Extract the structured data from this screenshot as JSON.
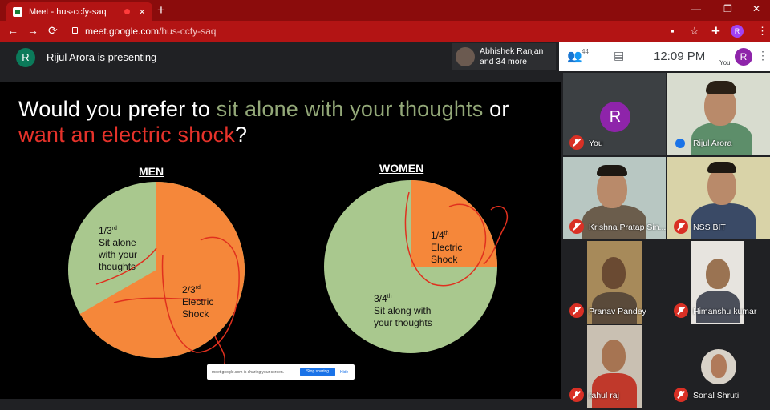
{
  "browser": {
    "tab_title": "Meet - hus-ccfy-saq",
    "tab_close": "×",
    "new_tab": "+",
    "url_domain": "meet.google.com",
    "url_path": "/hus-ccfy-saq",
    "profile_initial": "R",
    "back": "←",
    "forward": "→",
    "reload": "⟳",
    "window_controls": [
      "—",
      "❐",
      "✕"
    ]
  },
  "meet": {
    "presenter_initial": "R",
    "presenting_text": "Rijul Arora is presenting",
    "people_chip_line1": "Abhishek Ranjan",
    "people_chip_line2": "and 34 more",
    "participant_count": "44",
    "time": "12:09 PM",
    "you_label": "You",
    "you_initial": "R",
    "accent_color": "#1a73e8",
    "muted_color": "#d93025"
  },
  "slide": {
    "question_part1": "Would you prefer to ",
    "question_green": "sit alone with your thoughts",
    "question_part2": " or",
    "question_red": "want an electric shock",
    "question_end": "?",
    "men_heading": "MEN",
    "women_heading": "WOMEN",
    "men_alone_lines": [
      "1/3",
      "rd",
      "Sit alone",
      "with your",
      "thoughts"
    ],
    "men_shock_lines": [
      "2/3",
      "rd",
      "Electric",
      "Shock"
    ],
    "women_shock_lines": [
      "1/4",
      "th",
      "Electric",
      "Shock"
    ],
    "women_alone_lines": [
      "3/4",
      "th",
      "Sit along with",
      "your thoughts"
    ],
    "pie_green": "#a9c88e",
    "pie_orange": "#f5873a"
  },
  "share_banner": {
    "text": "meet.google.com is sharing your screen.",
    "stop_label": "Stop sharing",
    "hide_label": "Hide"
  },
  "participants": [
    {
      "name": "You",
      "muted": true
    },
    {
      "name": "Rijul Arora",
      "muted": false
    },
    {
      "name": "Krishna Pratap Sin...",
      "muted": true
    },
    {
      "name": "NSS BIT",
      "muted": true
    },
    {
      "name": "Pranav Pandey",
      "muted": true
    },
    {
      "name": "Himanshu kumar",
      "muted": true
    },
    {
      "name": "rahul raj",
      "muted": true
    },
    {
      "name": "Sonal Shruti",
      "muted": true
    }
  ]
}
